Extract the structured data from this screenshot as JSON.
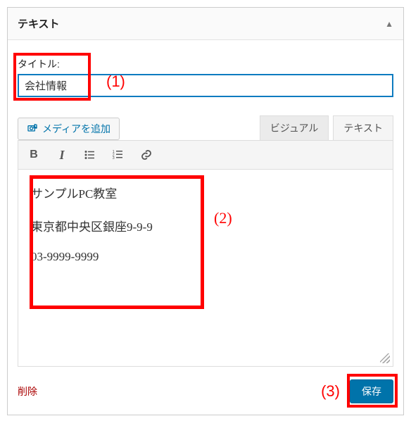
{
  "widget": {
    "header_title": "テキスト",
    "collapse_glyph": "▲"
  },
  "title_field": {
    "label": "タイトル:",
    "value": "会社情報"
  },
  "annotations": {
    "a1": "(1)",
    "a2": "(2)",
    "a3": "(3)"
  },
  "media_button": {
    "label": "メディアを追加"
  },
  "editor_tabs": {
    "visual": "ビジュアル",
    "text": "テキスト"
  },
  "toolbar": {
    "bold": "B",
    "italic": "I",
    "ul": "bullet-list",
    "ol": "numbered-list",
    "link": "link"
  },
  "content": {
    "line1": "サンプルPC教室",
    "line2": "東京都中央区銀座9-9-9",
    "line3": "03-9999-9999"
  },
  "footer": {
    "delete": "削除",
    "save": "保存"
  },
  "colors": {
    "accent": "#0073aa",
    "annotation": "#ff0000",
    "delete": "#a00"
  }
}
